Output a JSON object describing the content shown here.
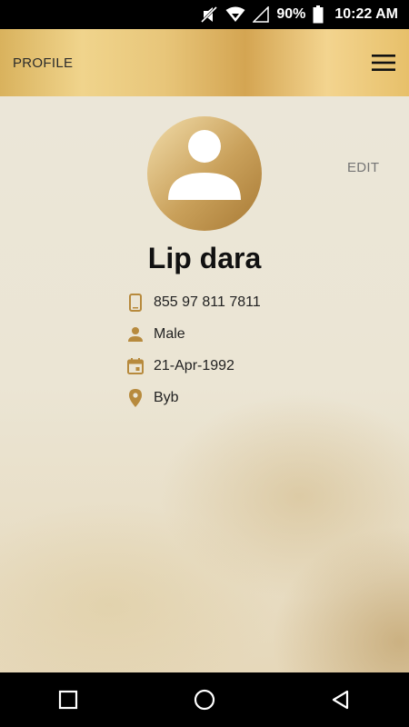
{
  "status_bar": {
    "battery": "90%",
    "time": "10:22 AM",
    "icons": [
      "mute-icon",
      "wifi-icon",
      "signal-icon",
      "battery-icon"
    ]
  },
  "header": {
    "title": "PROFILE",
    "menu_icon": "hamburger-menu-icon"
  },
  "profile": {
    "edit_label": "EDIT",
    "name": "Lip dara",
    "phone": "855 97 811 7811",
    "gender": "Male",
    "birthdate": "21-Apr-1992",
    "location": "Byb"
  },
  "nav_bar": {
    "icons": [
      "recent-apps-icon",
      "home-icon",
      "back-icon"
    ]
  },
  "colors": {
    "accent": "#b78a3d",
    "header_gold": "#e8c67a",
    "background": "#ebe6d8"
  }
}
